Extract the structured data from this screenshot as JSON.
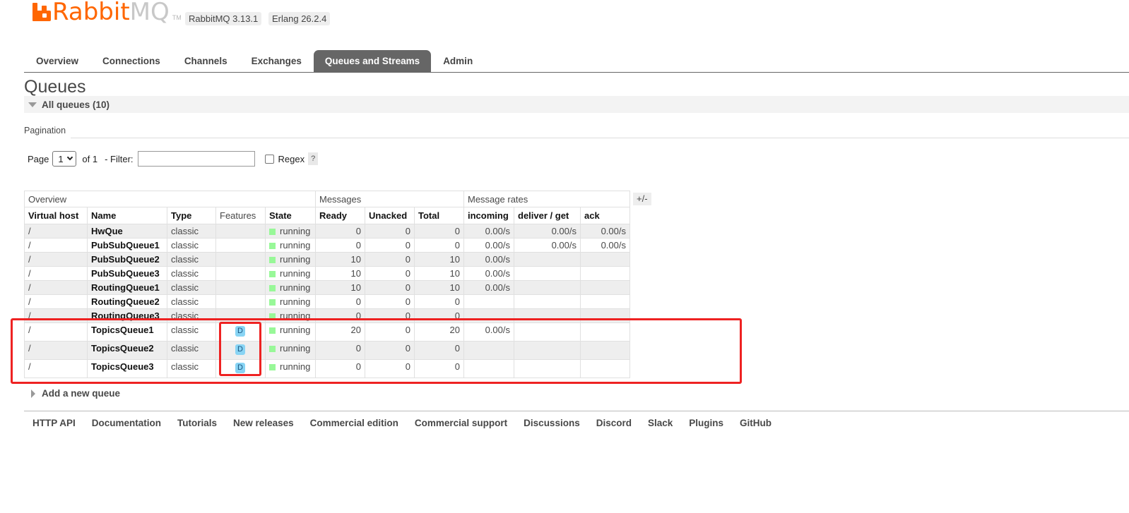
{
  "header": {
    "logo_text_a": "Rabbit",
    "logo_text_b": "MQ",
    "logo_tm": "TM",
    "version": "RabbitMQ 3.13.1",
    "erlang": "Erlang 26.2.4"
  },
  "tabs": [
    {
      "label": "Overview"
    },
    {
      "label": "Connections"
    },
    {
      "label": "Channels"
    },
    {
      "label": "Exchanges"
    },
    {
      "label": "Queues and Streams",
      "active": true
    },
    {
      "label": "Admin"
    }
  ],
  "page_title": "Queues",
  "section": {
    "label": "All queues (10)"
  },
  "pagination": {
    "label": "Pagination",
    "page_label": "Page",
    "page_value": "1",
    "of_label": "of 1",
    "filter_label": "- Filter:",
    "filter_value": "",
    "regex_label": "Regex",
    "help": "?"
  },
  "table": {
    "groups": [
      "Overview",
      "Messages",
      "Message rates"
    ],
    "toggle": "+/-",
    "columns": [
      "Virtual host",
      "Name",
      "Type",
      "Features",
      "State",
      "Ready",
      "Unacked",
      "Total",
      "incoming",
      "deliver / get",
      "ack"
    ],
    "rows": [
      {
        "vhost": "/",
        "name": "HwQue",
        "type": "classic",
        "features": "",
        "state": "running",
        "ready": "0",
        "unacked": "0",
        "total": "0",
        "incoming": "0.00/s",
        "deliver": "0.00/s",
        "ack": "0.00/s"
      },
      {
        "vhost": "/",
        "name": "PubSubQueue1",
        "type": "classic",
        "features": "",
        "state": "running",
        "ready": "0",
        "unacked": "0",
        "total": "0",
        "incoming": "0.00/s",
        "deliver": "0.00/s",
        "ack": "0.00/s"
      },
      {
        "vhost": "/",
        "name": "PubSubQueue2",
        "type": "classic",
        "features": "",
        "state": "running",
        "ready": "10",
        "unacked": "0",
        "total": "10",
        "incoming": "0.00/s",
        "deliver": "",
        "ack": ""
      },
      {
        "vhost": "/",
        "name": "PubSubQueue3",
        "type": "classic",
        "features": "",
        "state": "running",
        "ready": "10",
        "unacked": "0",
        "total": "10",
        "incoming": "0.00/s",
        "deliver": "",
        "ack": ""
      },
      {
        "vhost": "/",
        "name": "RoutingQueue1",
        "type": "classic",
        "features": "",
        "state": "running",
        "ready": "10",
        "unacked": "0",
        "total": "10",
        "incoming": "0.00/s",
        "deliver": "",
        "ack": ""
      },
      {
        "vhost": "/",
        "name": "RoutingQueue2",
        "type": "classic",
        "features": "",
        "state": "running",
        "ready": "0",
        "unacked": "0",
        "total": "0",
        "incoming": "",
        "deliver": "",
        "ack": ""
      },
      {
        "vhost": "/",
        "name": "RoutingQueue3",
        "type": "classic",
        "features": "",
        "state": "running",
        "ready": "0",
        "unacked": "0",
        "total": "0",
        "incoming": "",
        "deliver": "",
        "ack": ""
      },
      {
        "vhost": "/",
        "name": "TopicsQueue1",
        "type": "classic",
        "features": "D",
        "state": "running",
        "ready": "20",
        "unacked": "0",
        "total": "20",
        "incoming": "0.00/s",
        "deliver": "",
        "ack": ""
      },
      {
        "vhost": "/",
        "name": "TopicsQueue2",
        "type": "classic",
        "features": "D",
        "state": "running",
        "ready": "0",
        "unacked": "0",
        "total": "0",
        "incoming": "",
        "deliver": "",
        "ack": ""
      },
      {
        "vhost": "/",
        "name": "TopicsQueue3",
        "type": "classic",
        "features": "D",
        "state": "running",
        "ready": "0",
        "unacked": "0",
        "total": "0",
        "incoming": "",
        "deliver": "",
        "ack": ""
      }
    ]
  },
  "add_queue": "Add a new queue",
  "footer": [
    "HTTP API",
    "Documentation",
    "Tutorials",
    "New releases",
    "Commercial edition",
    "Commercial support",
    "Discussions",
    "Discord",
    "Slack",
    "Plugins",
    "GitHub"
  ],
  "colors": {
    "brand": "#ff6600",
    "running": "#98f898",
    "highlight": "#ee2222",
    "feature_badge": "#88d4f4"
  }
}
